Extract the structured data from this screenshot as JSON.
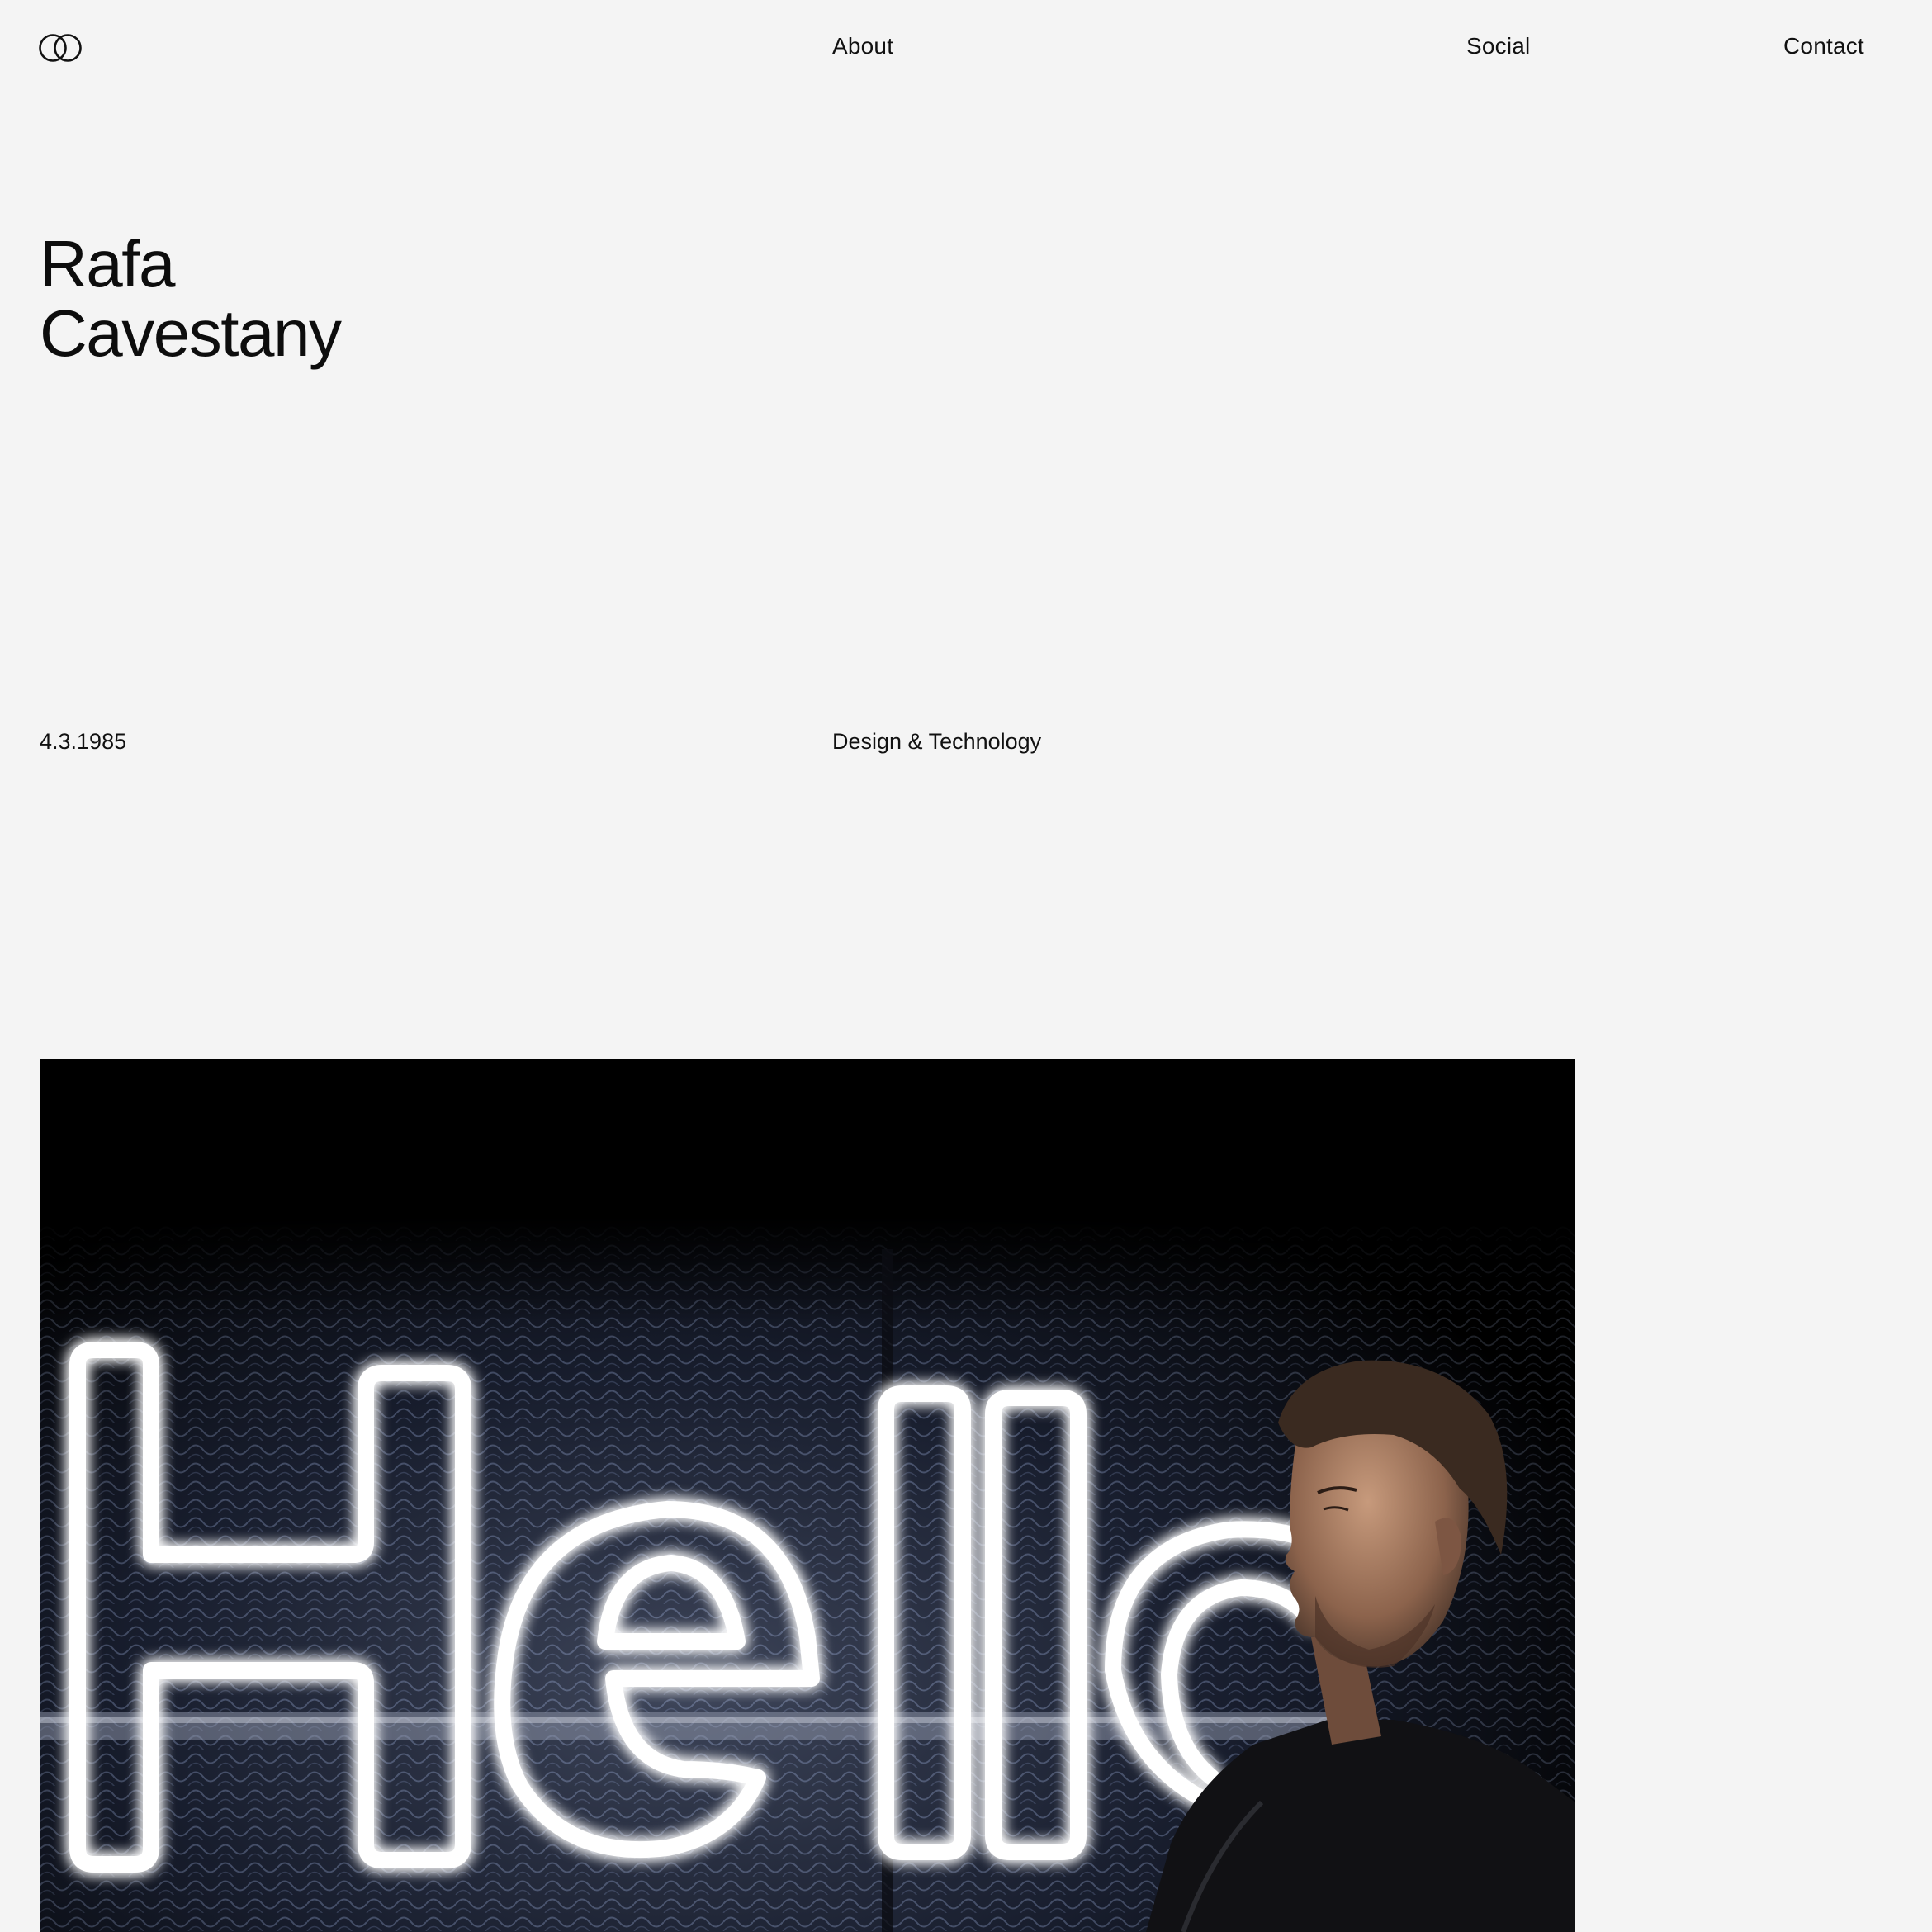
{
  "header": {
    "logo_icon": "interlocked-rings-icon",
    "nav": {
      "about": "About",
      "social": "Social",
      "contact": "Contact"
    }
  },
  "hero": {
    "first_name": "Rafa",
    "last_name": "Cavestany"
  },
  "meta": {
    "date": "4.3.1985",
    "field": "Design & Technology"
  },
  "photo": {
    "neon_text": "Hello",
    "subject": "man-in-black-sweater"
  },
  "colors": {
    "background": "#f4f4f4",
    "text": "#111111",
    "photo_background": "#000000",
    "neon": "#ffffff"
  }
}
